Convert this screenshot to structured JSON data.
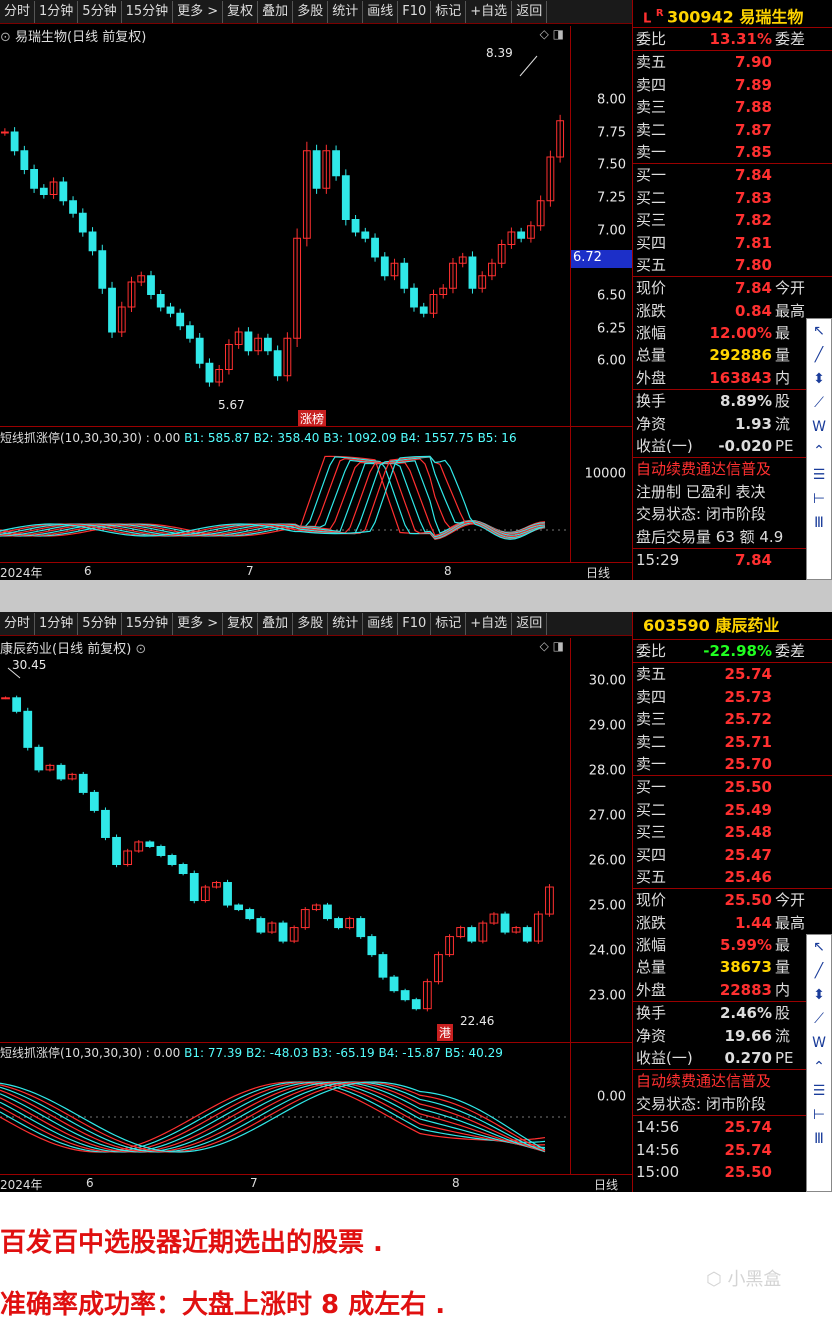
{
  "panel1": {
    "toolbar": [
      "分时",
      "1分钟",
      "5分钟",
      "15分钟",
      "更多 >",
      "复权",
      "叠加",
      "多股",
      "统计",
      "画线",
      "F10",
      "标记",
      "+自选",
      "返回"
    ],
    "chart_title": "易瑞生物(日线 前复权)",
    "controls": "◇ ◨",
    "price_labels": [
      "8.00",
      "7.75",
      "7.50",
      "7.25",
      "7.00",
      "6.50",
      "6.25",
      "6.00"
    ],
    "current_price_tag": "6.72",
    "high_label": "8.39",
    "low_label": "5.67",
    "badge": "涨榜",
    "ind_name": "短线抓涨停(10,30,30,30) : 0.00",
    "ind_vals": [
      "B1: 585.87",
      "B2: 358.40",
      "B3: 1092.09",
      "B4: 1557.75",
      "B5: 16"
    ],
    "ind_axis": "10000",
    "x_labels": [
      "2024年",
      "6",
      "7",
      "8"
    ],
    "period": "日线",
    "stock": {
      "code": "300942",
      "name": "易瑞生物",
      "mark": "L",
      "mark2": "R"
    },
    "weibi": {
      "k": "委比",
      "v": "13.31%",
      "t": "委差"
    },
    "sells": [
      [
        "卖五",
        "7.90"
      ],
      [
        "卖四",
        "7.89"
      ],
      [
        "卖三",
        "7.88"
      ],
      [
        "卖二",
        "7.87"
      ],
      [
        "卖一",
        "7.85"
      ]
    ],
    "buys": [
      [
        "买一",
        "7.84"
      ],
      [
        "买二",
        "7.83"
      ],
      [
        "买三",
        "7.82"
      ],
      [
        "买四",
        "7.81"
      ],
      [
        "买五",
        "7.80"
      ]
    ],
    "quote": [
      [
        "现价",
        "7.84",
        "今开"
      ],
      [
        "涨跌",
        "0.84",
        "最高"
      ],
      [
        "涨幅",
        "12.00%",
        "最"
      ],
      [
        "总量",
        "292886",
        "量"
      ],
      [
        "外盘",
        "163843",
        "内"
      ]
    ],
    "quote2": [
      [
        "换手",
        "8.89%",
        "股"
      ],
      [
        "净资",
        "1.93",
        "流"
      ],
      [
        "收益(一)",
        "-0.020",
        "PE"
      ]
    ],
    "notice1": "自动续费通达信普及",
    "notice2": "注册制 已盈利 表决",
    "status": "交易状态: 闭市阶段",
    "after": "盘后交易量 63 额 4.9",
    "ticks": [
      [
        "15:29",
        "7.84"
      ]
    ]
  },
  "panel2": {
    "toolbar": [
      "分时",
      "1分钟",
      "5分钟",
      "15分钟",
      "更多 >",
      "复权",
      "叠加",
      "多股",
      "统计",
      "画线",
      "F10",
      "标记",
      "+自选",
      "返回"
    ],
    "chart_title": "康辰药业(日线 前复权)",
    "controls": "◇ ◨",
    "price_labels": [
      "30.00",
      "29.00",
      "28.00",
      "27.00",
      "26.00",
      "25.00",
      "24.00",
      "23.00"
    ],
    "high_label": "30.45",
    "low_label": "22.46",
    "badge": "港",
    "ind_name": "短线抓涨停(10,30,30,30) : 0.00",
    "ind_vals": [
      "B1: 77.39",
      "B2: -48.03",
      "B3: -65.19",
      "B4: -15.87",
      "B5: 40.29"
    ],
    "ind_axis": "0.00",
    "x_labels": [
      "2024年",
      "6",
      "7",
      "8"
    ],
    "period": "日线",
    "stock": {
      "code": "603590",
      "name": "康辰药业"
    },
    "weibi": {
      "k": "委比",
      "v": "-22.98%",
      "t": "委差"
    },
    "sells": [
      [
        "卖五",
        "25.74"
      ],
      [
        "卖四",
        "25.73"
      ],
      [
        "卖三",
        "25.72"
      ],
      [
        "卖二",
        "25.71"
      ],
      [
        "卖一",
        "25.70"
      ]
    ],
    "buys": [
      [
        "买一",
        "25.50"
      ],
      [
        "买二",
        "25.49"
      ],
      [
        "买三",
        "25.48"
      ],
      [
        "买四",
        "25.47"
      ],
      [
        "买五",
        "25.46"
      ]
    ],
    "quote": [
      [
        "现价",
        "25.50",
        "今开"
      ],
      [
        "涨跌",
        "1.44",
        "最高"
      ],
      [
        "涨幅",
        "5.99%",
        "最"
      ],
      [
        "总量",
        "38673",
        "量"
      ],
      [
        "外盘",
        "22883",
        "内"
      ]
    ],
    "quote2": [
      [
        "换手",
        "2.46%",
        "股"
      ],
      [
        "净资",
        "19.66",
        "流"
      ],
      [
        "收益(一)",
        "0.270",
        "PE"
      ]
    ],
    "notice1": "自动续费通达信普及",
    "status": "交易状态: 闭市阶段",
    "ticks": [
      [
        "14:56",
        "25.74"
      ],
      [
        "14:56",
        "25.74"
      ],
      [
        "15:00",
        "25.50"
      ]
    ]
  },
  "tools": [
    "↖",
    "╱",
    "⬍",
    "⟋",
    "W",
    "⌃",
    "☰",
    "⊢",
    "Ⅲ"
  ],
  "caption1": "百发百中选股器近期选出的股票 .",
  "caption2": "准确率成功率：大盘上涨时 8 成左右 .",
  "watermark": "小黑盒"
}
